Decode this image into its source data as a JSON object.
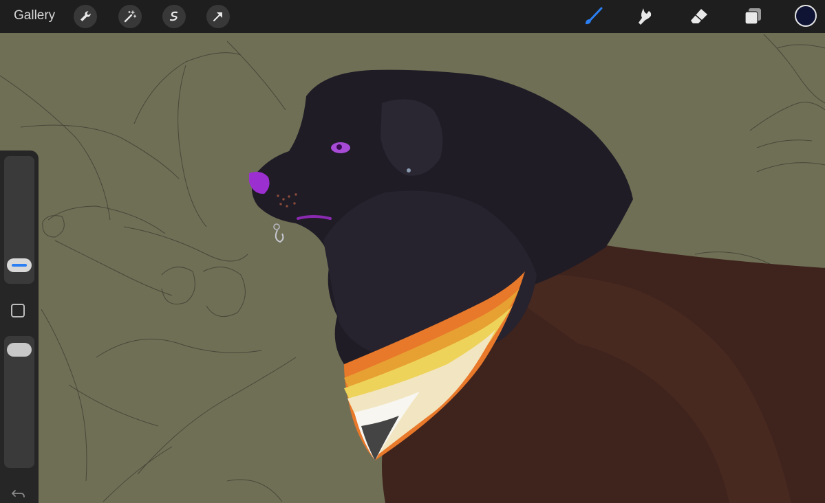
{
  "toolbar": {
    "gallery_label": "Gallery",
    "left_tools": [
      {
        "name": "actions",
        "icon": "wrench-icon"
      },
      {
        "name": "adjustments",
        "icon": "magic-wand-icon"
      },
      {
        "name": "selection",
        "icon": "selection-s-icon"
      },
      {
        "name": "transform",
        "icon": "arrow-icon"
      }
    ],
    "right_tools": [
      {
        "name": "brush",
        "icon": "brush-icon",
        "active": true
      },
      {
        "name": "smudge",
        "icon": "smudge-icon",
        "active": false
      },
      {
        "name": "eraser",
        "icon": "eraser-icon",
        "active": false
      },
      {
        "name": "layers",
        "icon": "layers-icon",
        "active": false
      }
    ],
    "current_color": "#0f1435",
    "active_tool_color": "#2b7ff2"
  },
  "sidebar": {
    "brush_size_level": 0.2,
    "brush_opacity_level": 1.0
  },
  "canvas": {
    "background_color": "#6f6f55",
    "subject": "dog-portrait-artwork"
  }
}
